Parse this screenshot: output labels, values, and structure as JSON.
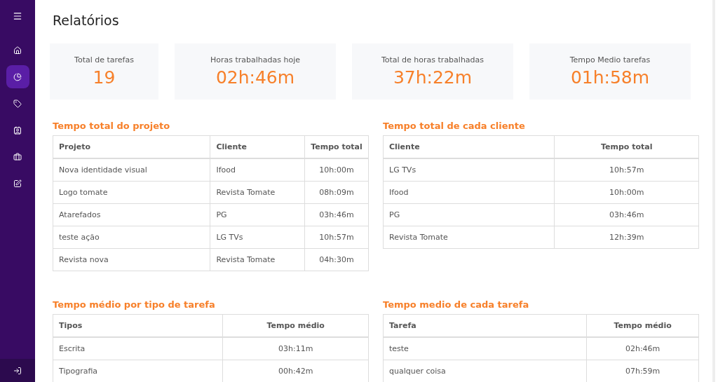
{
  "sidebar": {
    "items": [
      {
        "selected": false
      },
      {
        "selected": true
      },
      {
        "selected": false
      },
      {
        "selected": false
      },
      {
        "selected": false
      },
      {
        "selected": false
      }
    ]
  },
  "page_title": "Relatórios",
  "stats": [
    {
      "label": "Total de tarefas",
      "value": "19"
    },
    {
      "label": "Horas trabalhadas hoje",
      "value": "02h:46m"
    },
    {
      "label": "Total de horas trabalhadas",
      "value": "37h:22m"
    },
    {
      "label": "Tempo Medio tarefas",
      "value": "01h:58m"
    }
  ],
  "tables": [
    {
      "title": "Tempo total do projeto",
      "columns": [
        "Projeto",
        "Cliente",
        "Tempo total"
      ],
      "rows": [
        [
          "Nova identidade visual",
          "Ifood",
          "10h:00m"
        ],
        [
          "Logo tomate",
          "Revista Tomate",
          "08h:09m"
        ],
        [
          "Atarefados",
          "PG",
          "03h:46m"
        ],
        [
          "teste ação",
          "LG TVs",
          "10h:57m"
        ],
        [
          "Revista nova",
          "Revista Tomate",
          "04h:30m"
        ]
      ]
    },
    {
      "title": "Tempo total de cada cliente",
      "columns": [
        "Cliente",
        "Tempo total"
      ],
      "rows": [
        [
          "LG TVs",
          "10h:57m"
        ],
        [
          "Ifood",
          "10h:00m"
        ],
        [
          "PG",
          "03h:46m"
        ],
        [
          "Revista Tomate",
          "12h:39m"
        ]
      ]
    },
    {
      "title": "Tempo médio por tipo de tarefa",
      "columns": [
        "Tipos",
        "Tempo médio"
      ],
      "rows": [
        [
          "Escrita",
          "03h:11m"
        ],
        [
          "Tipografia",
          "00h:42m"
        ]
      ]
    },
    {
      "title": "Tempo medio de cada tarefa",
      "columns": [
        "Tarefa",
        "Tempo médio"
      ],
      "rows": [
        [
          "teste",
          "02h:46m"
        ],
        [
          "qualquer coisa",
          "07h:59m"
        ]
      ]
    }
  ]
}
